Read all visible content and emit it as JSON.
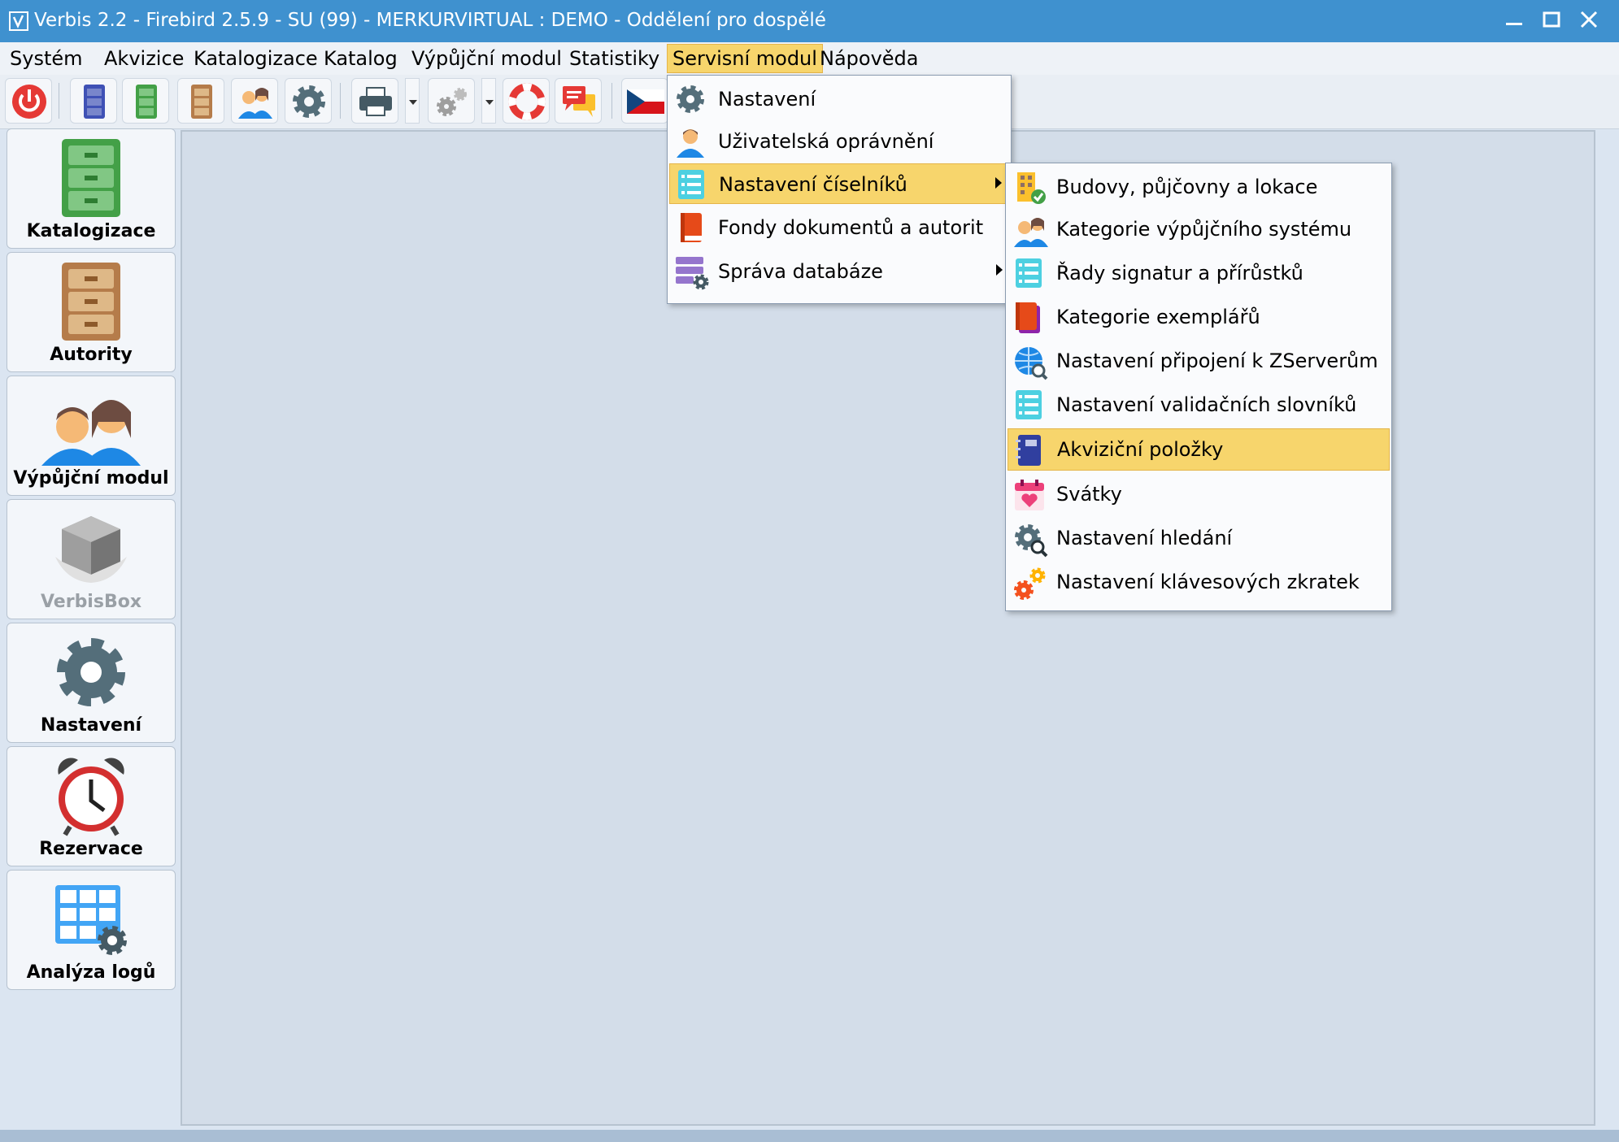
{
  "window": {
    "title": "Verbis 2.2 - Firebird 2.5.9 - SU (99) - MERKURVIRTUAL : DEMO - Oddělení pro dospělé"
  },
  "menubar": {
    "items": [
      {
        "label": "Systém"
      },
      {
        "label": "Akvizice"
      },
      {
        "label": "Katalogizace"
      },
      {
        "label": "Katalog"
      },
      {
        "label": "Výpůjční modul"
      },
      {
        "label": "Statistiky"
      },
      {
        "label": "Servisní modul"
      },
      {
        "label": "Nápověda"
      }
    ],
    "active": "Servisní modul"
  },
  "toolbar": {
    "icons": [
      "power-icon",
      "blue-cabinet-icon",
      "green-cabinet-icon",
      "brown-cabinet-icon",
      "users-icon",
      "gear-icon",
      "printer-icon",
      "gears-icon",
      "lifebuoy-icon",
      "chat-icon",
      "czech-flag-icon"
    ]
  },
  "sidebar": {
    "items": [
      {
        "label": "Katalogizace",
        "icon": "green-cabinet-icon"
      },
      {
        "label": "Autority",
        "icon": "brown-cabinet-icon"
      },
      {
        "label": "Výpůjční modul",
        "icon": "users-icon"
      },
      {
        "label": "VerbisBox",
        "icon": "box-icon",
        "disabled": true
      },
      {
        "label": "Nastavení",
        "icon": "gear-icon"
      },
      {
        "label": "Rezervace",
        "icon": "alarm-clock-icon"
      },
      {
        "label": "Analýza logů",
        "icon": "grid-gear-icon"
      }
    ]
  },
  "service_menu": {
    "items": [
      {
        "label": "Nastavení",
        "icon": "gear-icon"
      },
      {
        "label": "Uživatelská oprávnění",
        "icon": "user-icon"
      },
      {
        "label": "Nastavení číselníků",
        "icon": "list-icon",
        "submenu": true,
        "highlighted": true
      },
      {
        "label": "Fondy dokumentů a autorit",
        "icon": "book-icon"
      },
      {
        "label": "Správa databáze",
        "icon": "database-gear-icon",
        "submenu": true
      }
    ]
  },
  "codelist_submenu": {
    "items": [
      {
        "label": "Budovy, půjčovny a lokace",
        "icon": "building-check-icon"
      },
      {
        "label": "Kategorie výpůjčního systému",
        "icon": "users-icon"
      },
      {
        "label": "Řady signatur a přírůstků",
        "icon": "list-icon"
      },
      {
        "label": "Kategorie exemplářů",
        "icon": "book-icon"
      },
      {
        "label": "Nastavení připojení k ZServerům",
        "icon": "globe-search-icon"
      },
      {
        "label": "Nastavení validačních slovníků",
        "icon": "list-icon"
      },
      {
        "label": "Akviziční položky",
        "icon": "notebook-icon",
        "highlighted": true
      },
      {
        "label": "Svátky",
        "icon": "calendar-heart-icon"
      },
      {
        "label": "Nastavení hledání",
        "icon": "gear-search-icon"
      },
      {
        "label": "Nastavení klávesových zkratek",
        "icon": "gears-icon"
      }
    ]
  },
  "colors": {
    "titlebar": "#3f91cf",
    "highlight": "#f7d56c",
    "workspace": "#d3dde9"
  }
}
